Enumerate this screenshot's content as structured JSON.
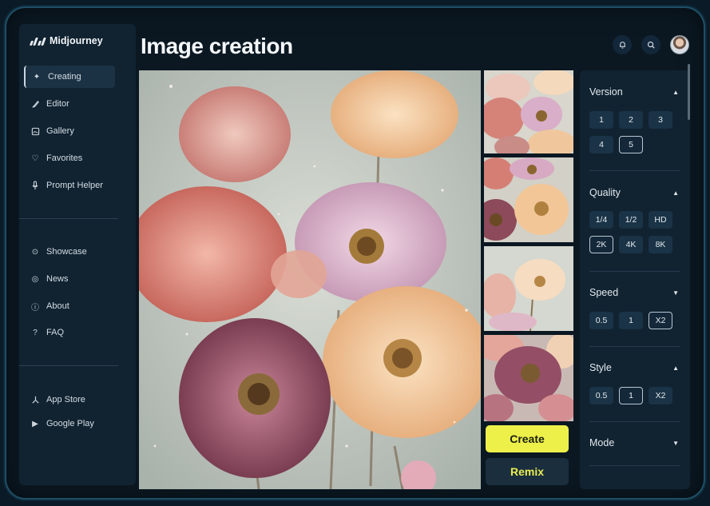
{
  "brand": {
    "name": "Midjourney"
  },
  "page": {
    "title": "Image creation"
  },
  "sidebar": {
    "items": [
      {
        "label": "Creating",
        "icon": "sparkle-icon",
        "active": true
      },
      {
        "label": "Editor",
        "icon": "brush-icon"
      },
      {
        "label": "Gallery",
        "icon": "gallery-icon"
      },
      {
        "label": "Favorites",
        "icon": "heart-icon"
      },
      {
        "label": "Prompt Helper",
        "icon": "microphone-icon"
      }
    ],
    "secondary": [
      {
        "label": "Showcase",
        "icon": "showcase-icon"
      },
      {
        "label": "News",
        "icon": "news-icon"
      },
      {
        "label": "About",
        "icon": "info-icon"
      },
      {
        "label": "FAQ",
        "icon": "question-icon"
      }
    ],
    "stores": [
      {
        "label": "App Store",
        "icon": "app-store-icon"
      },
      {
        "label": "Google Play",
        "icon": "google-play-icon"
      }
    ]
  },
  "actions": {
    "create": "Create",
    "remix": "Remix"
  },
  "settings": {
    "version": {
      "label": "Version",
      "options": [
        "1",
        "2",
        "3",
        "4",
        "5"
      ],
      "selected": "5"
    },
    "quality": {
      "label": "Quality",
      "options": [
        "1/4",
        "1/2",
        "HD",
        "2K",
        "4K",
        "8K"
      ],
      "selected": "2K"
    },
    "speed": {
      "label": "Speed",
      "options": [
        "0.5",
        "1",
        "X2"
      ],
      "selected": "X2"
    },
    "style": {
      "label": "Style",
      "options": [
        "0.5",
        "1",
        "X2"
      ],
      "selected": "1"
    },
    "mode": {
      "label": "Mode"
    }
  },
  "colors": {
    "accent": "#eef04a",
    "panel": "#112331",
    "background": "#0b1822"
  }
}
